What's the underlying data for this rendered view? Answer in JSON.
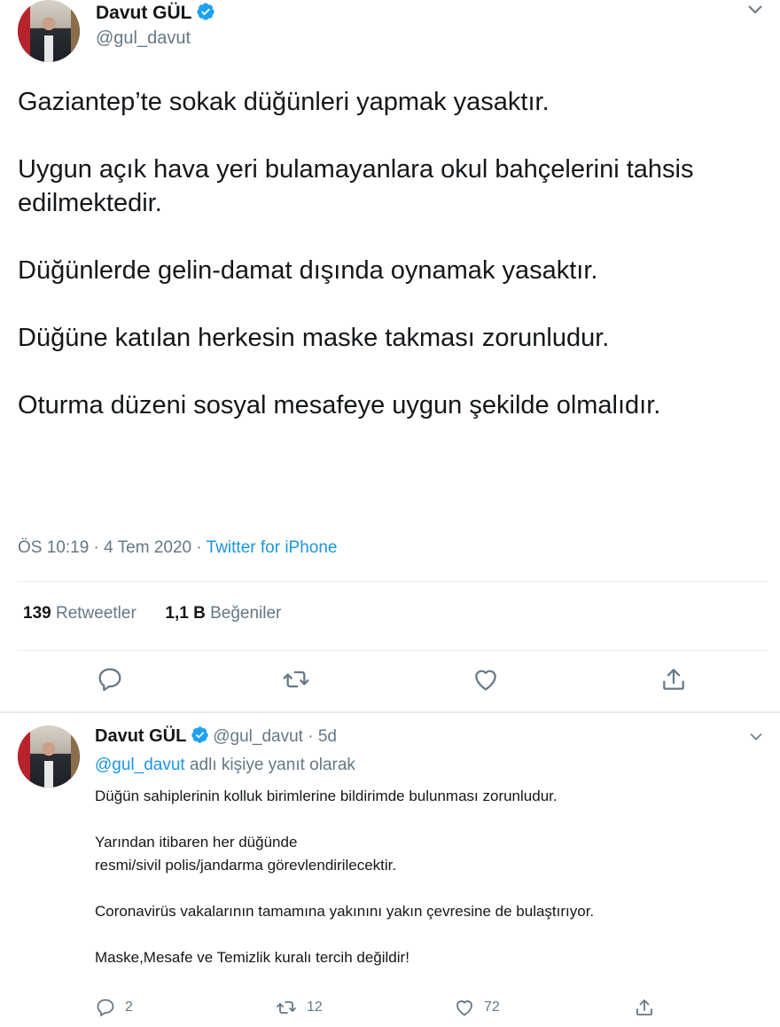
{
  "main_tweet": {
    "author_name": "Davut GÜL",
    "author_handle": "@gul_davut",
    "text": "Gaziantep’te sokak düğünleri yapmak yasaktır.\n\nUygun açık hava yeri bulamayanlara okul bahçelerini tahsis edilmektedir.\n\nDüğünlerde gelin-damat dışında oynamak yasaktır.\n\nDüğüne katılan herkesin maske takması zorunludur.\n\nOturma düzeni sosyal mesafeye uygun şekilde olmalıdır.",
    "timestamp": "ÖS 10:19 · 4 Tem 2020 · ",
    "source": "Twitter for iPhone",
    "retweets_count": "139",
    "retweets_label": "Retweetler",
    "likes_count": "1,1 B",
    "likes_label": "Beğeniler"
  },
  "reply_tweet": {
    "author_name": "Davut GÜL",
    "author_handle": "@gul_davut · 5d",
    "reply_mention": "@gul_davut",
    "reply_suffix": " adlı kişiye yanıt olarak",
    "text": "Düğün sahiplerinin kolluk birimlerine bildirimde bulunması zorunludur.\n\nYarından itibaren her düğünde\nresmi/sivil  polis/jandarma görevlendirilecektir.\n\nCoronavirüs vakalarının tamamına yakınını yakın çevresine de bulaştırıyor.\n\nMaske,Mesafe ve Temizlik kuralı tercih değildir!",
    "reply_count": "2",
    "retweet_count": "12",
    "like_count": "72"
  },
  "colors": {
    "brand_blue": "#1b95e0",
    "secondary_text": "#657786",
    "primary_text": "#14171a",
    "divider": "#e6ecf0"
  },
  "icons": [
    "verified-badge-icon",
    "chevron-down-icon",
    "reply-icon",
    "retweet-icon",
    "like-icon",
    "share-icon"
  ]
}
